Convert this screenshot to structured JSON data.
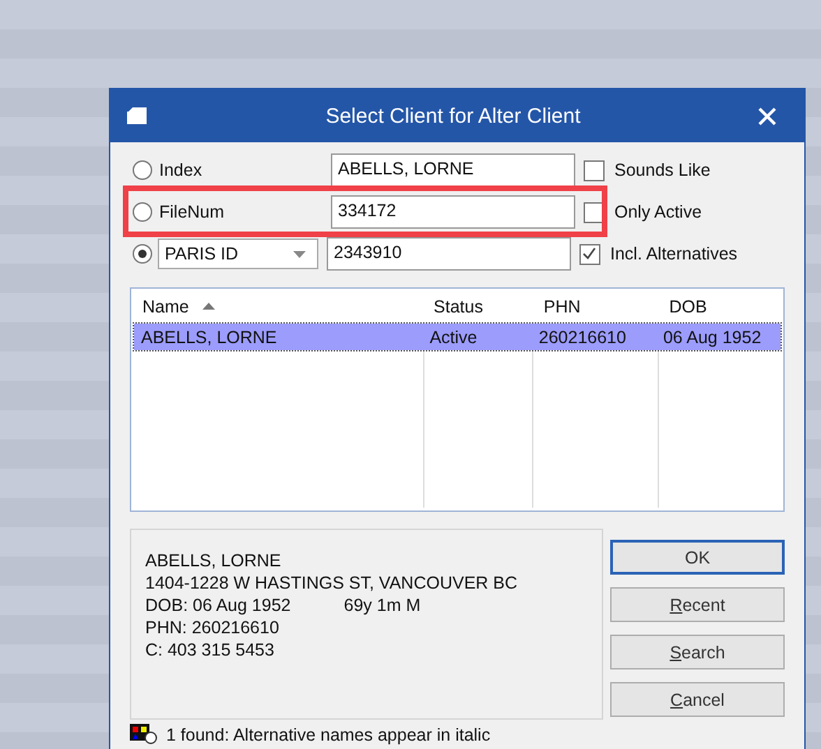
{
  "window": {
    "title": "Select Client for Alter Client"
  },
  "search_rows": [
    {
      "kind": "radio",
      "label": "Index",
      "selected": false,
      "value": "ABELLS, LORNE",
      "option": {
        "label": "Sounds Like",
        "checked": false
      },
      "highlighted": false
    },
    {
      "kind": "radio",
      "label": "FileNum",
      "selected": false,
      "value": "334172",
      "option": {
        "label": "Only Active",
        "checked": false
      },
      "highlighted": true
    },
    {
      "kind": "dropdown",
      "label": "PARIS ID",
      "selected": true,
      "value": "2343910",
      "option": {
        "label": "Incl. Alternatives",
        "checked": true
      },
      "highlighted": false
    }
  ],
  "table": {
    "columns": [
      {
        "label": "Name",
        "sorted": true
      },
      {
        "label": "Status",
        "sorted": false
      },
      {
        "label": "PHN",
        "sorted": false
      },
      {
        "label": "DOB",
        "sorted": false
      }
    ],
    "rows": [
      {
        "selected": true,
        "cells": [
          "ABELLS, LORNE",
          "Active",
          "260216610",
          "06 Aug 1952"
        ]
      }
    ]
  },
  "details": {
    "name": "ABELLS, LORNE",
    "address": "1404-1228 W HASTINGS ST, VANCOUVER BC",
    "dob": "DOB: 06 Aug 1952",
    "age": "69y 1m M",
    "phn": "PHN: 260216610",
    "contact": "C: 403 315 5453"
  },
  "buttons": [
    {
      "label": "OK",
      "default": true
    },
    {
      "mnemonic": "R",
      "label": "ecent",
      "default": false
    },
    {
      "mnemonic": "S",
      "label": "earch",
      "default": false
    },
    {
      "mnemonic": "C",
      "label": "ancel",
      "default": false
    }
  ],
  "status_bar": {
    "text": "1 found: Alternative names appear in italic"
  }
}
